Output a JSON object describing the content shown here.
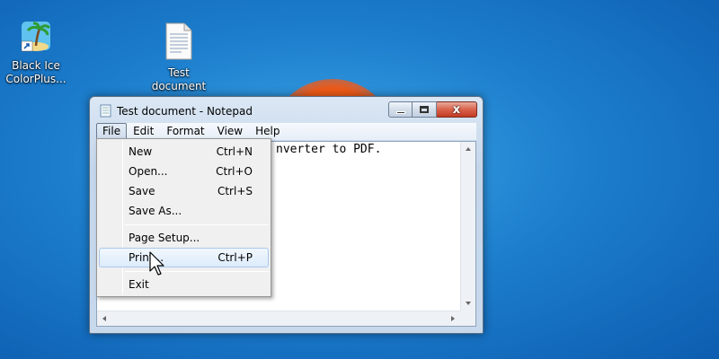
{
  "desktop": {
    "icons": [
      {
        "label_line1": "Black Ice",
        "label_line2": "ColorPlus..."
      },
      {
        "label_line1": "Test",
        "label_line2": "document"
      }
    ]
  },
  "window": {
    "title": "Test document - Notepad",
    "close_glyph": "x",
    "menu": [
      "File",
      "Edit",
      "Format",
      "View",
      "Help"
    ],
    "content_text": "nverter to PDF."
  },
  "file_menu": {
    "items": [
      {
        "label": "New",
        "shortcut": "Ctrl+N"
      },
      {
        "label": "Open...",
        "shortcut": "Ctrl+O"
      },
      {
        "label": "Save",
        "shortcut": "Ctrl+S"
      },
      {
        "label": "Save As...",
        "shortcut": ""
      },
      {
        "label": "Page Setup...",
        "shortcut": ""
      },
      {
        "label": "Print...",
        "shortcut": "Ctrl+P"
      },
      {
        "label": "Exit",
        "shortcut": ""
      }
    ],
    "highlighted": "Print..."
  },
  "colors": {
    "desktop_blue": "#1d7fce",
    "menu_highlight": "#dcebfb",
    "close_red": "#c23b24"
  }
}
